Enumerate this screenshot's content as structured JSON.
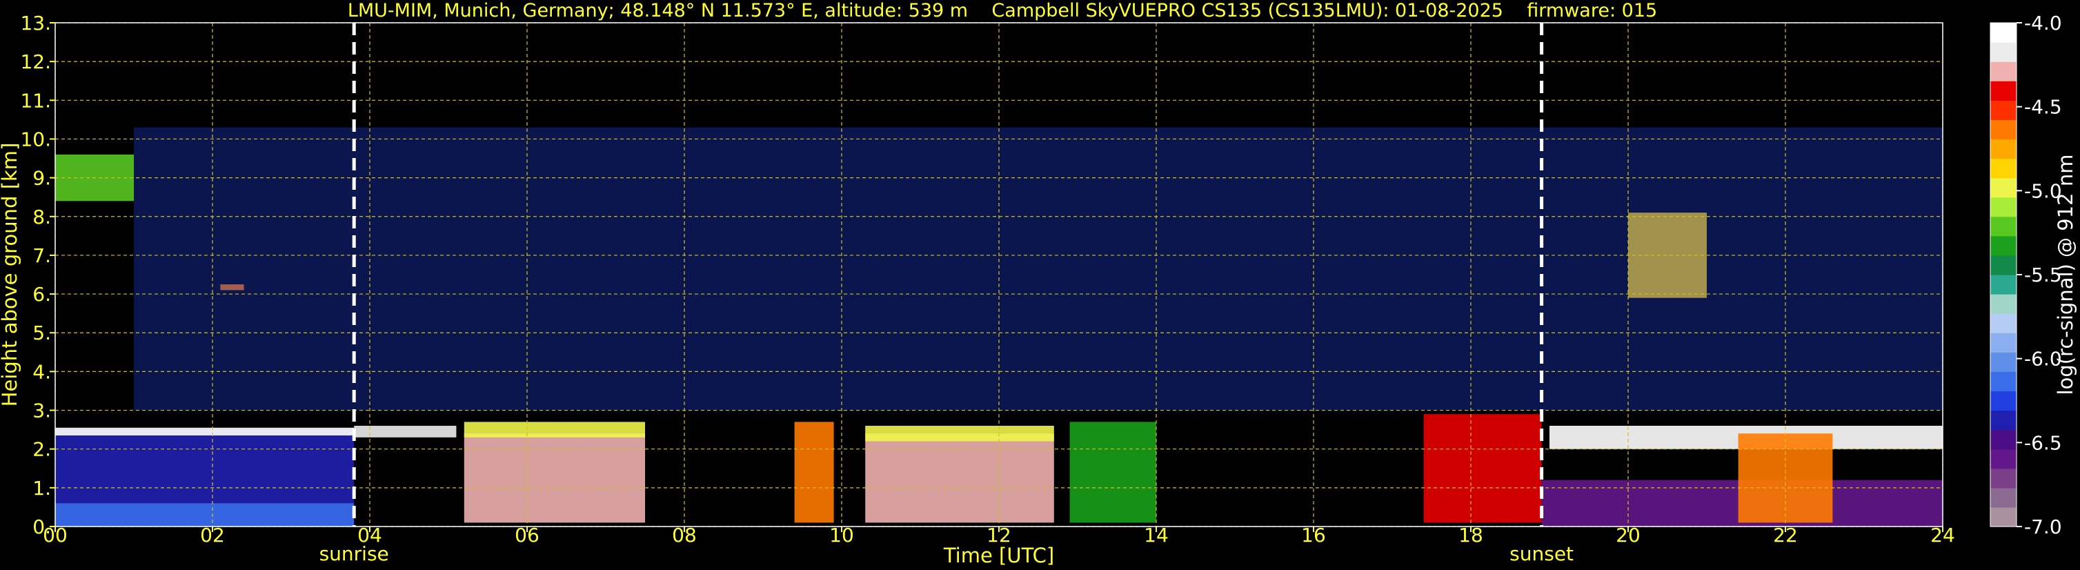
{
  "chart_data": {
    "type": "heatmap",
    "title": "LMU-MIM, Munich, Germany; 48.148° N 11.573° E, altitude: 539 m    Campbell SkyVUEPRO CS135 (CS135LMU): 01-08-2025    firmware: 015",
    "xlabel": "Time [UTC]",
    "ylabel": "Height above ground [km]",
    "xlim": [
      0,
      24
    ],
    "ylim": [
      0,
      13
    ],
    "x_ticks": [
      "00",
      "02",
      "04",
      "06",
      "08",
      "10",
      "12",
      "14",
      "16",
      "18",
      "20",
      "22",
      "24"
    ],
    "y_ticks": [
      "0.",
      "1.",
      "2.",
      "3.",
      "4.",
      "5.",
      "6.",
      "7.",
      "8.",
      "9.",
      "10.",
      "11.",
      "12.",
      "13."
    ],
    "grid": true,
    "grid_color": "#d4c21a",
    "colorbar": {
      "label": "log(rc-signal) @ 912 nm",
      "range": [
        -7.0,
        -4.0
      ],
      "ticks": [
        "-4.0",
        "-4.5",
        "-5.0",
        "-5.5",
        "-6.0",
        "-6.5",
        "-7.0"
      ],
      "colors": [
        "#a8909c",
        "#8a6a90",
        "#7a3f88",
        "#62188a",
        "#4a0d86",
        "#2020b0",
        "#1f3fe0",
        "#3a6ee8",
        "#5f8ee8",
        "#8aaef0",
        "#b4ccf4",
        "#a0d6c8",
        "#2aa890",
        "#148a4a",
        "#1aa01a",
        "#58c820",
        "#a8ec3a",
        "#eef54a",
        "#ffd400",
        "#ffa800",
        "#ff7a00",
        "#ff3000",
        "#e80000",
        "#f0b0b0",
        "#ececec",
        "#ffffff"
      ]
    },
    "markers": [
      {
        "label": "sunrise",
        "time": 3.8
      },
      {
        "label": "sunset",
        "time": 18.9
      }
    ],
    "cloud_layers": [
      {
        "t0": 0.0,
        "t1": 3.8,
        "base_km": 0.0,
        "top_km": 2.5,
        "level": -6.4
      },
      {
        "t0": 0.0,
        "t1": 3.8,
        "base_km": 0.0,
        "top_km": 0.6,
        "level": -6.1
      },
      {
        "t0": 0.0,
        "t1": 3.8,
        "base_km": 2.35,
        "top_km": 2.55,
        "level": -4.1
      },
      {
        "t0": 3.8,
        "t1": 5.1,
        "base_km": 2.3,
        "top_km": 2.6,
        "level": -4.2
      },
      {
        "t0": 0.0,
        "t1": 1.0,
        "base_km": 8.4,
        "top_km": 9.6,
        "level": -5.2
      },
      {
        "t0": 2.1,
        "t1": 2.4,
        "base_km": 6.1,
        "top_km": 6.25,
        "level": -4.6
      },
      {
        "t0": 5.2,
        "t1": 7.5,
        "base_km": 0.1,
        "top_km": 2.4,
        "level": -4.3
      },
      {
        "t0": 5.2,
        "t1": 7.5,
        "base_km": 2.3,
        "top_km": 2.7,
        "level": -5.0
      },
      {
        "t0": 9.4,
        "t1": 9.9,
        "base_km": 0.1,
        "top_km": 2.7,
        "level": -4.6
      },
      {
        "t0": 10.3,
        "t1": 12.7,
        "base_km": 0.1,
        "top_km": 2.4,
        "level": -4.3
      },
      {
        "t0": 10.3,
        "t1": 12.7,
        "base_km": 2.2,
        "top_km": 2.6,
        "level": -5.0
      },
      {
        "t0": 12.9,
        "t1": 14.0,
        "base_km": 0.1,
        "top_km": 2.7,
        "level": -5.3
      },
      {
        "t0": 17.4,
        "t1": 18.9,
        "base_km": 0.1,
        "top_km": 2.9,
        "level": -4.4
      },
      {
        "t0": 18.9,
        "t1": 24.0,
        "base_km": 0.0,
        "top_km": 1.2,
        "level": -6.6
      },
      {
        "t0": 19.0,
        "t1": 24.0,
        "base_km": 2.0,
        "top_km": 2.6,
        "level": -4.1
      },
      {
        "t0": 21.4,
        "t1": 22.6,
        "base_km": 0.1,
        "top_km": 2.4,
        "level": -4.6
      },
      {
        "t0": 20.0,
        "t1": 21.0,
        "base_km": 5.9,
        "top_km": 8.1,
        "level": -4.9
      },
      {
        "t0": 1.0,
        "t1": 24.0,
        "base_km": 3.0,
        "top_km": 10.3,
        "level": -6.2
      }
    ]
  }
}
